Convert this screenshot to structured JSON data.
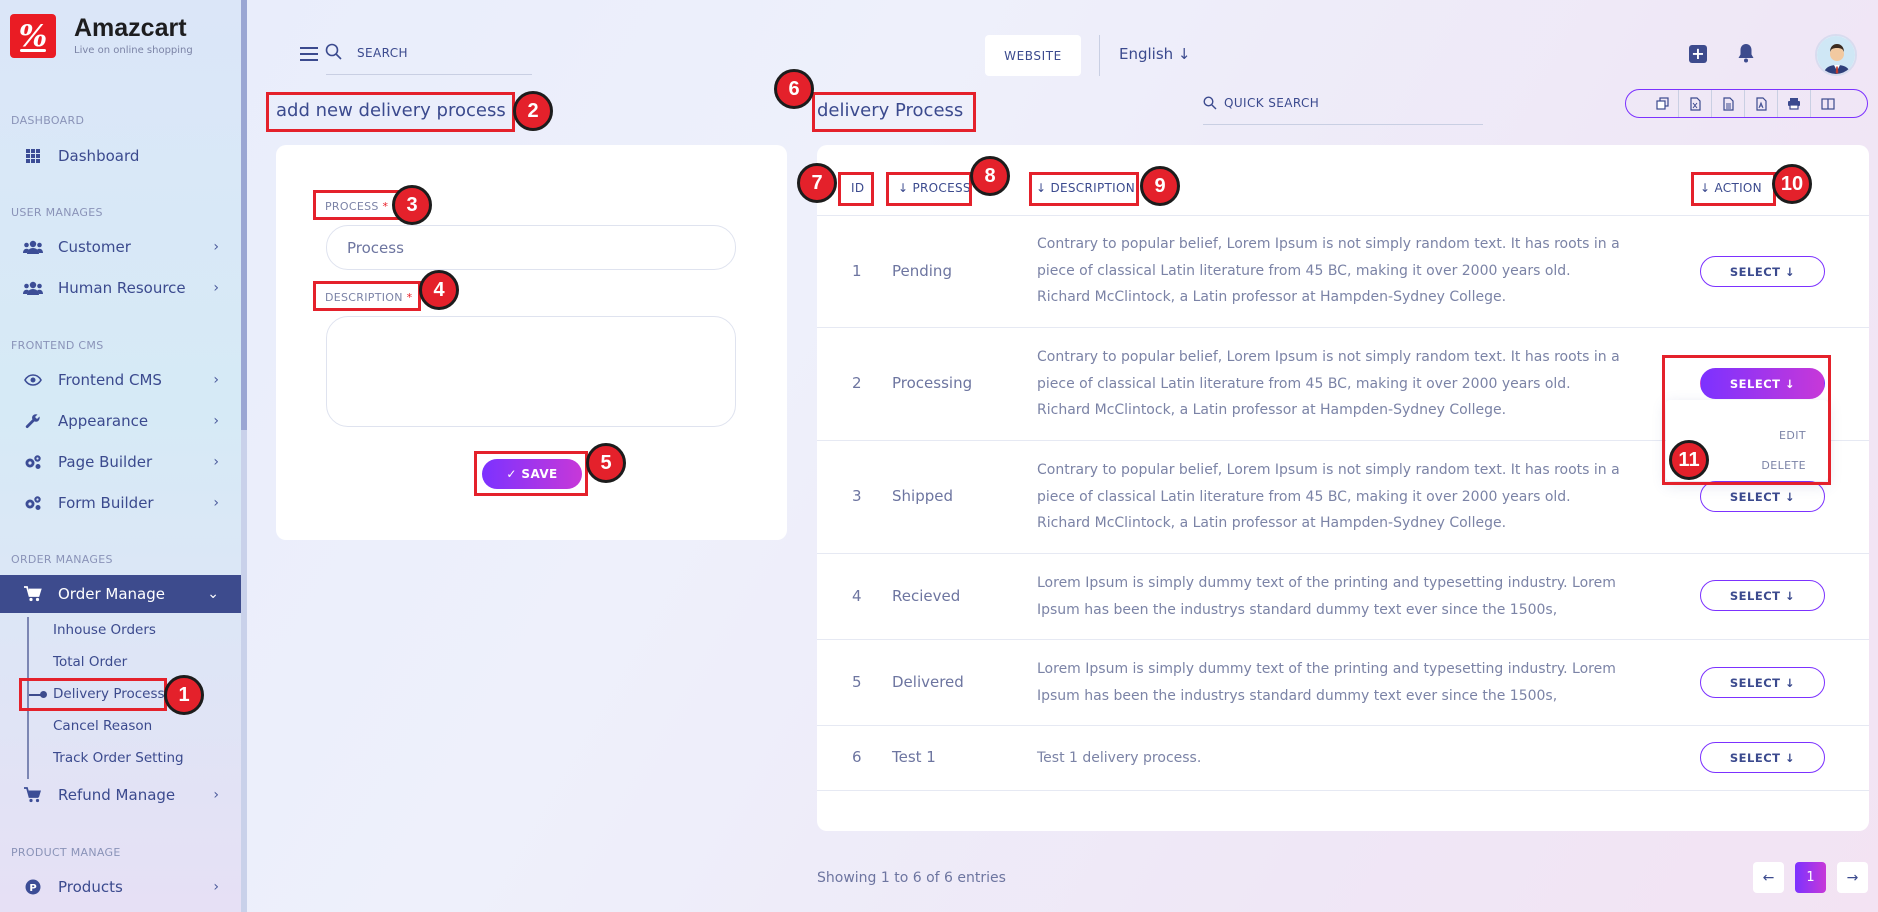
{
  "brand": {
    "name": "Amazcart",
    "tagline": "Live on online shopping",
    "logo_glyph": "%"
  },
  "sidebar": {
    "sections": [
      "DASHBOARD",
      "USER MANAGES",
      "FRONTEND CMS",
      "ORDER MANAGES",
      "PRODUCT MANAGE"
    ],
    "items": [
      {
        "label": "Dashboard",
        "icon": "grid-icon"
      },
      {
        "label": "Customer",
        "icon": "users-icon"
      },
      {
        "label": "Human Resource",
        "icon": "users-icon"
      },
      {
        "label": "Frontend CMS",
        "icon": "eye-icon"
      },
      {
        "label": "Appearance",
        "icon": "wrench-icon"
      },
      {
        "label": "Page Builder",
        "icon": "gears-icon"
      },
      {
        "label": "Form Builder",
        "icon": "gears-icon"
      },
      {
        "label": "Order Manage",
        "icon": "cart-icon"
      },
      {
        "label": "Refund Manage",
        "icon": "cart-icon"
      },
      {
        "label": "Products",
        "icon": "product-icon"
      }
    ],
    "sub_items": [
      "Inhouse Orders",
      "Total Order",
      "Delivery Process",
      "Cancel Reason",
      "Track Order Setting"
    ],
    "active_color": "#3d4b8d"
  },
  "topbar": {
    "search_label": "SEARCH",
    "website_label": "WEBSITE",
    "language": "English ↓"
  },
  "form": {
    "title": "add new delivery process",
    "process_label": "PROCESS",
    "process_placeholder": "Process",
    "description_label": "DESCRIPTION",
    "required_mark": "*",
    "save_label": "✓ SAVE"
  },
  "list": {
    "title": "delivery Process",
    "quick_search": "QUICK SEARCH",
    "columns": [
      "ID",
      "↓ PROCESS",
      "↓ DESCRIPTION",
      "↓ ACTION"
    ],
    "rows": [
      {
        "id": "1",
        "process": "Pending",
        "description": "Contrary to popular belief, Lorem Ipsum is not simply random text. It has roots in a piece of classical Latin literature from 45 BC, making it over 2000 years old. Richard McClintock, a Latin professor at Hampden-Sydney College.",
        "action": "SELECT ↓"
      },
      {
        "id": "2",
        "process": "Processing",
        "description": "Contrary to popular belief, Lorem Ipsum is not simply random text. It has roots in a piece of classical Latin literature from 45 BC, making it over 2000 years old. Richard McClintock, a Latin professor at Hampden-Sydney College.",
        "action": "SELECT ↓"
      },
      {
        "id": "3",
        "process": "Shipped",
        "description": "Contrary to popular belief, Lorem Ipsum is not simply random text. It has roots in a piece of classical Latin literature from 45 BC, making it over 2000 years old. Richard McClintock, a Latin professor at Hampden-Sydney College.",
        "action": "SELECT ↓"
      },
      {
        "id": "4",
        "process": "Recieved",
        "description": "Lorem Ipsum is simply dummy text of the printing and typesetting industry. Lorem Ipsum has been the industrys standard dummy text ever since the 1500s,",
        "action": "SELECT ↓"
      },
      {
        "id": "5",
        "process": "Delivered",
        "description": "Lorem Ipsum is simply dummy text of the printing and typesetting industry. Lorem Ipsum has been the industrys standard dummy text ever since the 1500s,",
        "action": "SELECT ↓"
      },
      {
        "id": "6",
        "process": "Test 1",
        "description": "Test 1 delivery process.",
        "action": "SELECT ↓"
      }
    ],
    "dropdown": {
      "edit": "EDIT",
      "delete": "DELETE"
    },
    "showing": "Showing 1 to 6 of 6 entries",
    "pagination": {
      "prev": "←",
      "current": "1",
      "next": "→"
    }
  },
  "annotations": [
    "1",
    "2",
    "3",
    "4",
    "5",
    "6",
    "7",
    "8",
    "9",
    "10",
    "11"
  ],
  "accent_color": "#7c32ff",
  "annotation_color": "#e4212b"
}
